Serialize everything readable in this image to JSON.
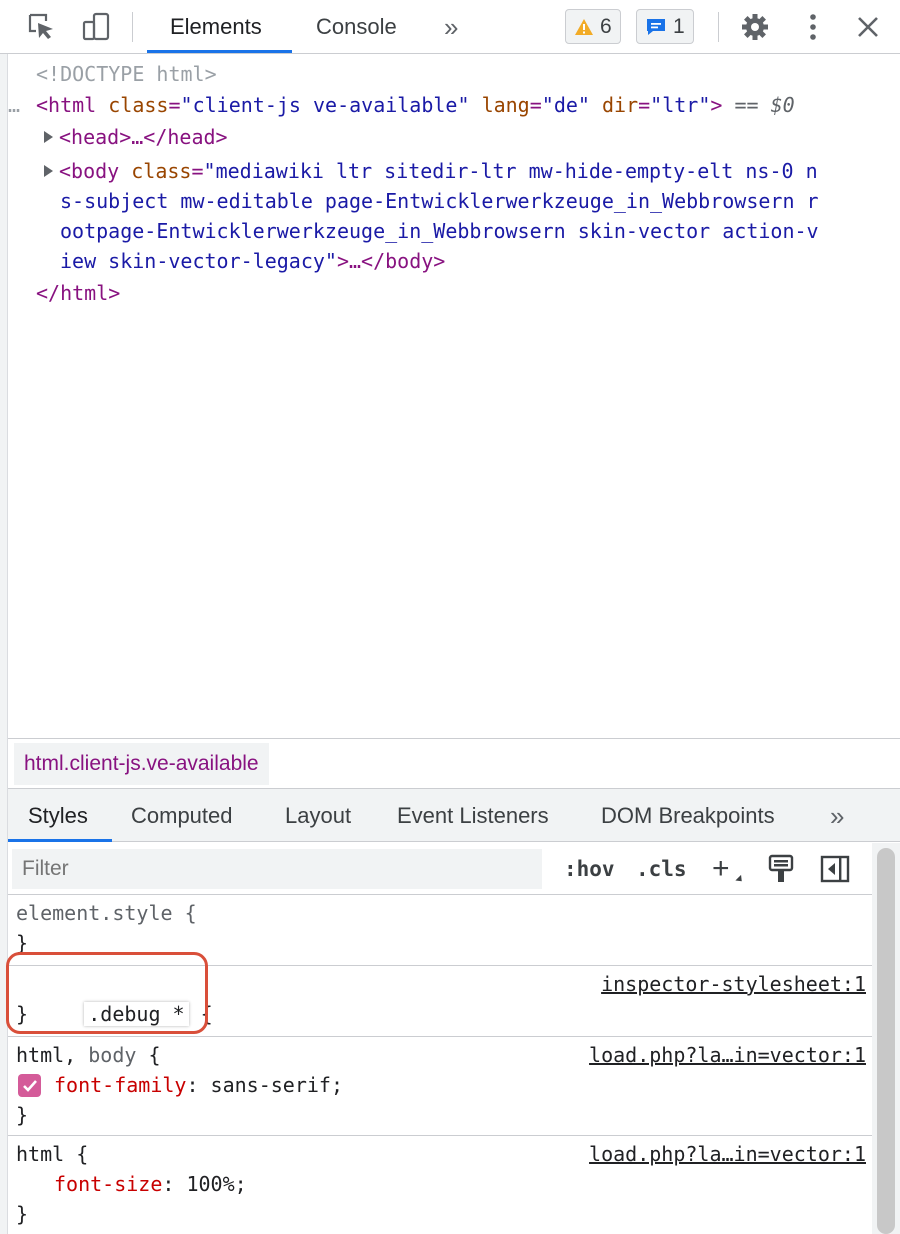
{
  "toolbar": {
    "tabs": [
      {
        "label": "Elements"
      },
      {
        "label": "Console"
      }
    ],
    "more_tabs_glyph": "»",
    "warnings_count": "6",
    "messages_count": "1",
    "icons": {
      "inspect": "inspect-element-icon",
      "device": "device-toggle-icon",
      "warning": "warning-icon",
      "message": "message-icon",
      "settings": "gear-icon",
      "menu": "kebab-menu-icon",
      "close": "close-icon"
    },
    "colors": {
      "accent": "#1a73e8",
      "warning": "#f2ab26",
      "message": "#1a73e8"
    }
  },
  "dom": {
    "doctype": "<!DOCTYPE html>",
    "selected_marker": "…",
    "html_open_tag": "<html",
    "html_attr1_name": "class",
    "html_attr1_value": "\"client-js ve-available\"",
    "html_attr2_name": "lang",
    "html_attr2_value": "\"de\"",
    "html_attr3_name": "dir",
    "html_attr3_value": "\"ltr\"",
    "html_close_bracket": ">",
    "eq_marker": "== $0",
    "head_line": "<head>…</head>",
    "body_open": "<body",
    "body_attr_name": "class",
    "body_attr_value_l1": "\"mediawiki ltr sitedir-ltr mw-hide-empty-elt ns-0 n",
    "body_attr_value_l2": "s-subject mw-editable page-Entwicklerwerkzeuge_in_Webbrowsern r",
    "body_attr_value_l3": "ootpage-Entwicklerwerkzeuge_in_Webbrowsern skin-vector action-v",
    "body_attr_value_l4": "iew skin-vector-legacy\"",
    "body_close": ">…</body>",
    "html_end": "</html>"
  },
  "breadcrumb": "html.client-js.ve-available",
  "styles_tabs": [
    {
      "label": "Styles"
    },
    {
      "label": "Computed"
    },
    {
      "label": "Layout"
    },
    {
      "label": "Event Listeners"
    },
    {
      "label": "DOM Breakpoints"
    }
  ],
  "styles_more_glyph": "»",
  "filter": {
    "placeholder": "Filter",
    "hov": ":hov",
    "cls": ".cls",
    "plus": "+"
  },
  "rules": [
    {
      "selector": "element.style {",
      "close": "}"
    },
    {
      "selector": ".debug *",
      "brace": " {",
      "close": "}",
      "source": "inspector-stylesheet:1"
    },
    {
      "selector_main": "html,",
      "selector_dim": " body",
      "brace": " {",
      "prop": "font-family",
      "value": ": sans-serif;",
      "close": "}",
      "source": "load.php?la…in=vector:1"
    },
    {
      "selector": "html {",
      "prop": "font-size",
      "value": ": 100%;",
      "close": "}",
      "source": "load.php?la…in=vector:1"
    }
  ]
}
